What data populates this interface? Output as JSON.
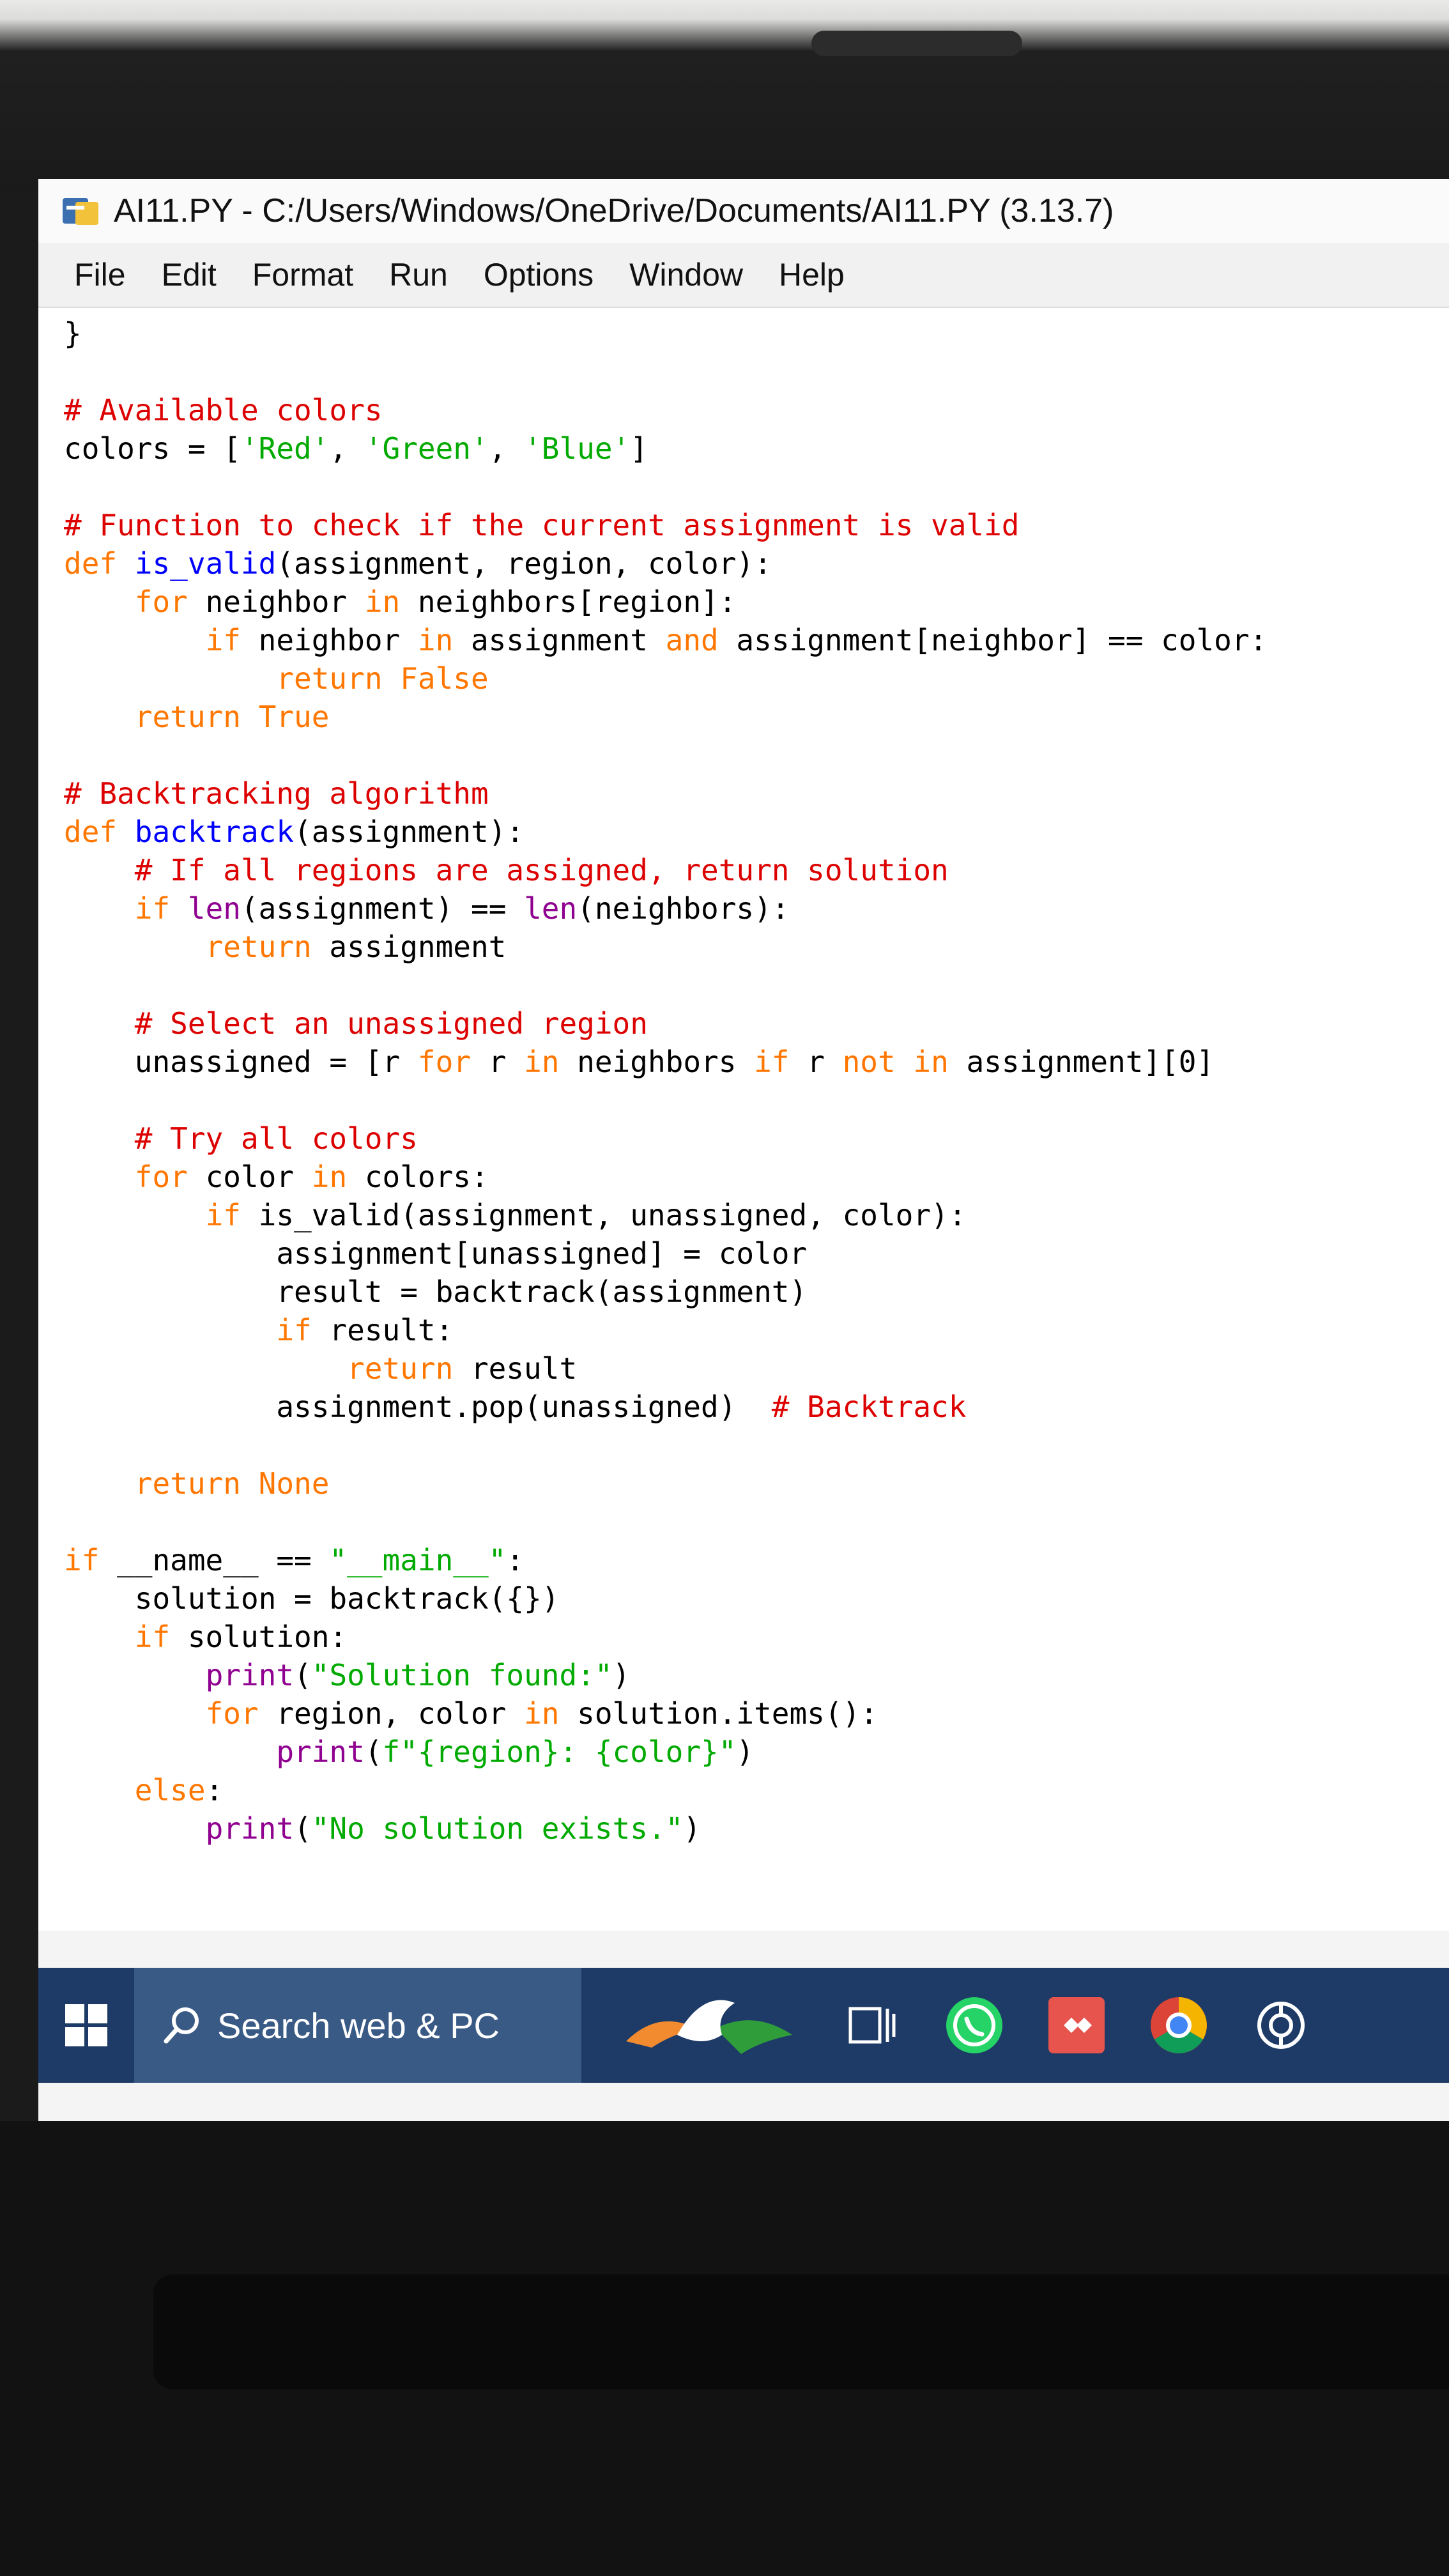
{
  "window": {
    "title": "AI11.PY - C:/Users/Windows/OneDrive/Documents/AI11.PY (3.13.7)"
  },
  "menu": [
    "File",
    "Edit",
    "Format",
    "Run",
    "Options",
    "Window",
    "Help"
  ],
  "code_lines": [
    "}",
    "",
    "# Available colors",
    "colors = ['Red', 'Green', 'Blue']",
    "",
    "# Function to check if the current assignment is valid",
    "def is_valid(assignment, region, color):",
    "    for neighbor in neighbors[region]:",
    "        if neighbor in assignment and assignment[neighbor] == color:",
    "            return False",
    "    return True",
    "",
    "# Backtracking algorithm",
    "def backtrack(assignment):",
    "    # If all regions are assigned, return solution",
    "    if len(assignment) == len(neighbors):",
    "        return assignment",
    "",
    "    # Select an unassigned region",
    "    unassigned = [r for r in neighbors if r not in assignment][0]",
    "",
    "    # Try all colors",
    "    for color in colors:",
    "        if is_valid(assignment, unassigned, color):",
    "            assignment[unassigned] = color",
    "            result = backtrack(assignment)",
    "            if result:",
    "                return result",
    "            assignment.pop(unassigned)  # Backtrack",
    "",
    "    return None",
    "",
    "if __name__ == \"__main__\":",
    "    solution = backtrack({})",
    "    if solution:",
    "        print(\"Solution found:\")",
    "        for region, color in solution.items():",
    "            print(f\"{region}: {color}\")",
    "    else:",
    "        print(\"No solution exists.\")"
  ],
  "taskbar": {
    "search_placeholder": "Search web & PC",
    "icons": [
      "windows-start-icon",
      "search-icon",
      "task-view-icon",
      "whatsapp-icon",
      "anydesk-icon",
      "chrome-icon",
      "chatgpt-icon"
    ]
  },
  "colors": {
    "keyword": "#ff7700",
    "comment": "#dd0000",
    "string": "#00aa00",
    "definition": "#0000ff",
    "builtin": "#900090",
    "taskbar": "#1d3b66"
  }
}
